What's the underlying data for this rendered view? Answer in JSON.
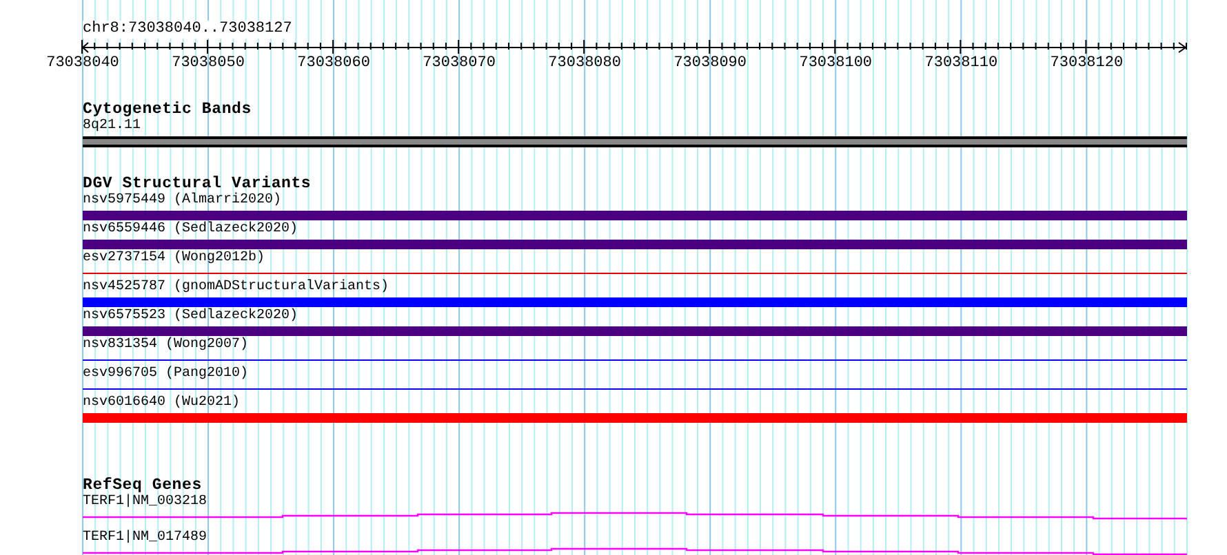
{
  "ruler": {
    "range": "chr8:73038040..73038127",
    "labels": [
      "73038040",
      "73038050",
      "73038060",
      "73038070",
      "73038080",
      "73038090",
      "73038100",
      "73038110",
      "73038120"
    ]
  },
  "cytogenetic_bands": {
    "title": "Cytogenetic Bands",
    "items": [
      {
        "label": "8q21.11"
      }
    ]
  },
  "dgv_structural_variants": {
    "title": "DGV Structural Variants",
    "items": [
      {
        "label": "nsv5975449 (Almarri2020)",
        "kind": "thick",
        "color": "#4b0082"
      },
      {
        "label": "nsv6559446 (Sedlazeck2020)",
        "kind": "thick",
        "color": "#4b0082"
      },
      {
        "label": "esv2737154 (Wong2012b)",
        "kind": "thin",
        "color": "#e00000"
      },
      {
        "label": "nsv4525787 (gnomADStructuralVariants)",
        "kind": "thick",
        "color": "#0000ff"
      },
      {
        "label": "nsv6575523 (Sedlazeck2020)",
        "kind": "thick",
        "color": "#4b0082"
      },
      {
        "label": "nsv831354 (Wong2007)",
        "kind": "thin",
        "color": "#0000ff"
      },
      {
        "label": "esv996705 (Pang2010)",
        "kind": "thin",
        "color": "#0000ff"
      },
      {
        "label": "nsv6016640 (Wu2021)",
        "kind": "thick",
        "color": "#ff0000"
      }
    ]
  },
  "refseq_genes": {
    "title": "RefSeq Genes",
    "items": [
      {
        "label": "TERF1|NM_003218"
      },
      {
        "label": "TERF1|NM_017489"
      }
    ]
  }
}
